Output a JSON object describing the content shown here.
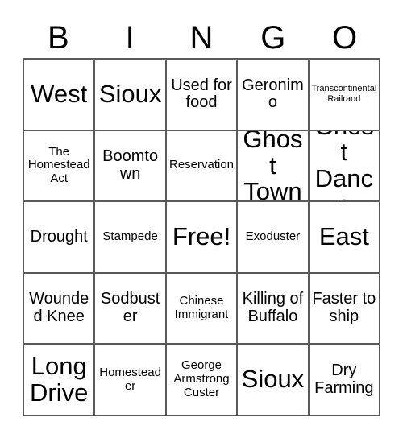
{
  "card": {
    "header_letters": [
      "B",
      "I",
      "N",
      "G",
      "O"
    ],
    "grid_line_color": "#5a5a5a",
    "background_color": "#ffffff",
    "text_color": "#000000",
    "columns": 5,
    "rows": 5,
    "cells": [
      [
        {
          "text": "West",
          "size": "xl"
        },
        {
          "text": "Sioux",
          "size": "xl"
        },
        {
          "text": "Used for food",
          "size": "md"
        },
        {
          "text": "Geronimo",
          "size": "md"
        },
        {
          "text": "Transcontinental Railraod",
          "size": "xs"
        }
      ],
      [
        {
          "text": "The Homestead Act",
          "size": "sm"
        },
        {
          "text": "Boomtown",
          "size": "md"
        },
        {
          "text": "Reservation",
          "size": "sm"
        },
        {
          "text": "Ghost Town",
          "size": "xl"
        },
        {
          "text": "Ghost Dance",
          "size": "xl"
        }
      ],
      [
        {
          "text": "Drought",
          "size": "md"
        },
        {
          "text": "Stampede",
          "size": "sm"
        },
        {
          "text": "Free!",
          "size": "xl"
        },
        {
          "text": "Exoduster",
          "size": "sm"
        },
        {
          "text": "East",
          "size": "xl"
        }
      ],
      [
        {
          "text": "Wounded Knee",
          "size": "md"
        },
        {
          "text": "Sodbuster",
          "size": "md"
        },
        {
          "text": "Chinese Immigrant",
          "size": "sm"
        },
        {
          "text": "Killing of Buffalo",
          "size": "md"
        },
        {
          "text": "Faster to ship",
          "size": "md"
        }
      ],
      [
        {
          "text": "Long Drive",
          "size": "xl"
        },
        {
          "text": "Homesteader",
          "size": "sm"
        },
        {
          "text": "George Armstrong Custer",
          "size": "sm"
        },
        {
          "text": "Sioux",
          "size": "xl"
        },
        {
          "text": "Dry Farming",
          "size": "md"
        }
      ]
    ]
  }
}
